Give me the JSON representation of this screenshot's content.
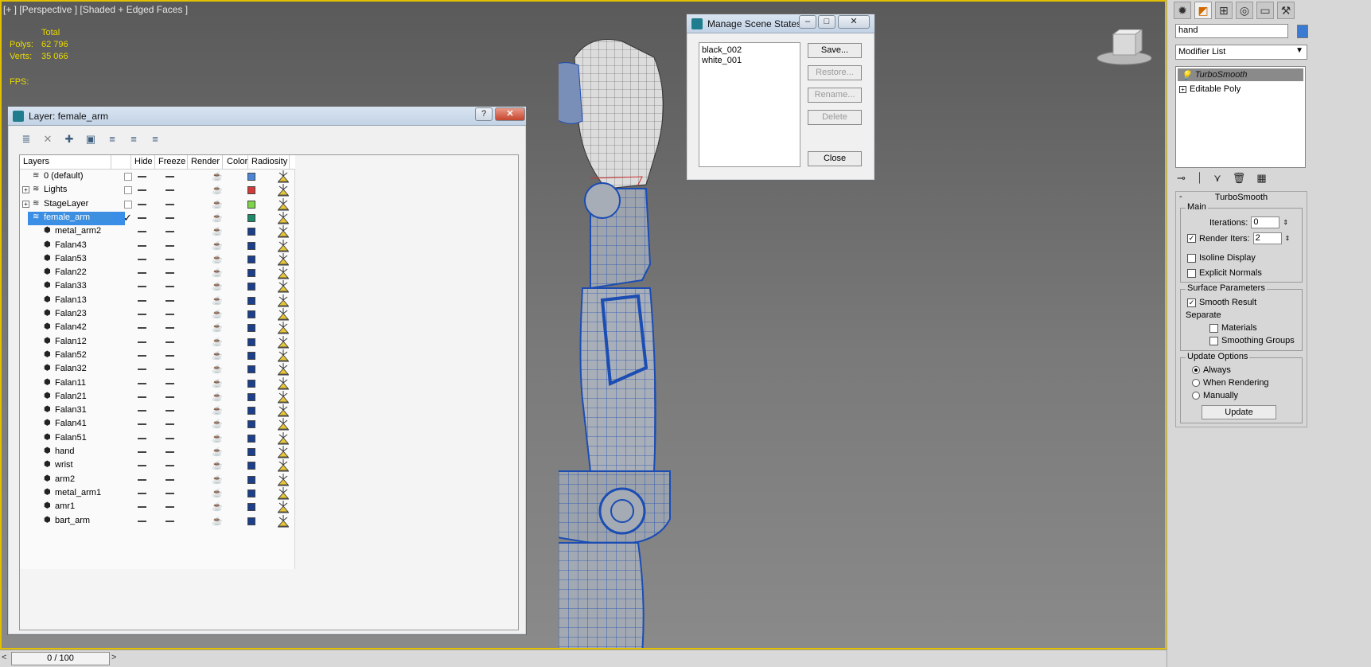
{
  "viewport": {
    "label": "[+ ] [Perspective ] [Shaded + Edged Faces ]",
    "stats": {
      "total_label": "Total",
      "polys_label": "Polys:",
      "polys_value": "62 796",
      "verts_label": "Verts:",
      "verts_value": "35 066",
      "fps_label": "FPS:"
    }
  },
  "timeline": {
    "left": "<",
    "value": "0 / 100",
    "right": ">"
  },
  "layer_window": {
    "title": "Layer: female_arm",
    "help_btn": "?",
    "close_btn": "✕",
    "columns": [
      "Layers",
      "Hide",
      "Freeze",
      "Render",
      "Color",
      "Radiosity"
    ],
    "layers": [
      {
        "name": "0 (default)",
        "color": "#4a86d6"
      },
      {
        "name": "Lights",
        "color": "#d23a3a"
      },
      {
        "name": "StageLayer",
        "color": "#7fd44a"
      },
      {
        "name": "female_arm",
        "color": "#1f8a6a"
      }
    ],
    "objects": [
      "metal_arm2",
      "Falan43",
      "Falan53",
      "Falan22",
      "Falan33",
      "Falan13",
      "Falan23",
      "Falan42",
      "Falan12",
      "Falan52",
      "Falan32",
      "Falan11",
      "Falan21",
      "Falan31",
      "Falan41",
      "Falan51",
      "hand",
      "wrist",
      "arm2",
      "metal_arm1",
      "amr1",
      "bart_arm"
    ],
    "object_color": "#1b3f8a"
  },
  "mss_window": {
    "title": "Manage Scene States",
    "states": [
      "black_002",
      "white_001"
    ],
    "buttons": {
      "save": "Save...",
      "restore": "Restore...",
      "rename": "Rename...",
      "delete": "Delete",
      "close": "Close"
    }
  },
  "command_panel": {
    "object_name": "hand",
    "object_color": "#3a7ad2",
    "modifier_list": "Modifier List",
    "stack": [
      "TurboSmooth",
      "Editable Poly"
    ],
    "rollout_title": "TurboSmooth",
    "main_group": "Main",
    "iterations_label": "Iterations:",
    "iterations_value": "0",
    "render_iters_label": "Render Iters:",
    "render_iters_value": "2",
    "isoline_label": "Isoline Display",
    "explicit_label": "Explicit Normals",
    "surface_group": "Surface Parameters",
    "smooth_label": "Smooth Result",
    "separate_label": "Separate",
    "materials_label": "Materials",
    "smoothing_label": "Smoothing Groups",
    "update_group": "Update Options",
    "always_label": "Always",
    "when_rendering_label": "When Rendering",
    "manually_label": "Manually",
    "update_btn": "Update"
  },
  "colors": {
    "accent": "#e0c000",
    "selection": "#3a8ee6",
    "wire": "#1b4db3"
  }
}
